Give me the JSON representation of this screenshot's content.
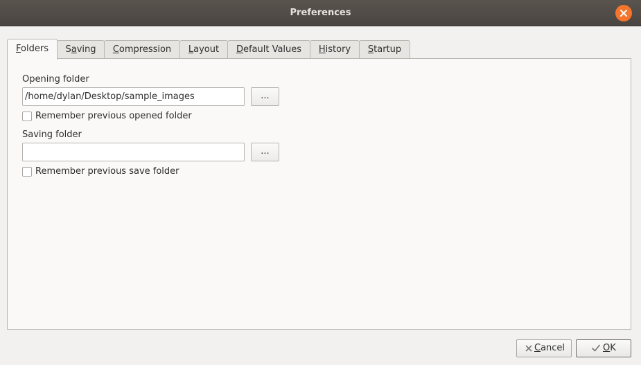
{
  "window": {
    "title": "Preferences",
    "close_icon": "close-icon",
    "close_color": "#f4752b"
  },
  "tabs": [
    {
      "label": "Folders",
      "mnemonic": "F",
      "rest": "olders",
      "active": true
    },
    {
      "label": "Saving",
      "mnemonic": "a",
      "pre": "S",
      "rest": "ving"
    },
    {
      "label": "Compression",
      "mnemonic": "C",
      "rest": "ompression"
    },
    {
      "label": "Layout",
      "mnemonic": "L",
      "rest": "ayout"
    },
    {
      "label": "Default Values",
      "mnemonic": "D",
      "rest": "efault Values"
    },
    {
      "label": "History",
      "mnemonic": "H",
      "rest": "istory"
    },
    {
      "label": "Startup",
      "mnemonic": "S",
      "rest": "tartup"
    }
  ],
  "folders": {
    "opening_label": "Opening folder",
    "opening_value": "/home/dylan/Desktop/sample_images",
    "opening_browse": "...",
    "remember_opened_label": "Remember previous opened folder",
    "remember_opened_checked": false,
    "saving_label": "Saving folder",
    "saving_value": "",
    "saving_browse": "...",
    "remember_save_label": "Remember previous save folder",
    "remember_save_checked": false
  },
  "buttons": {
    "cancel": {
      "icon": "cancel-icon",
      "mnemonic": "C",
      "rest": "ancel"
    },
    "ok": {
      "icon": "check-icon",
      "mnemonic": "O",
      "rest": "K"
    }
  }
}
